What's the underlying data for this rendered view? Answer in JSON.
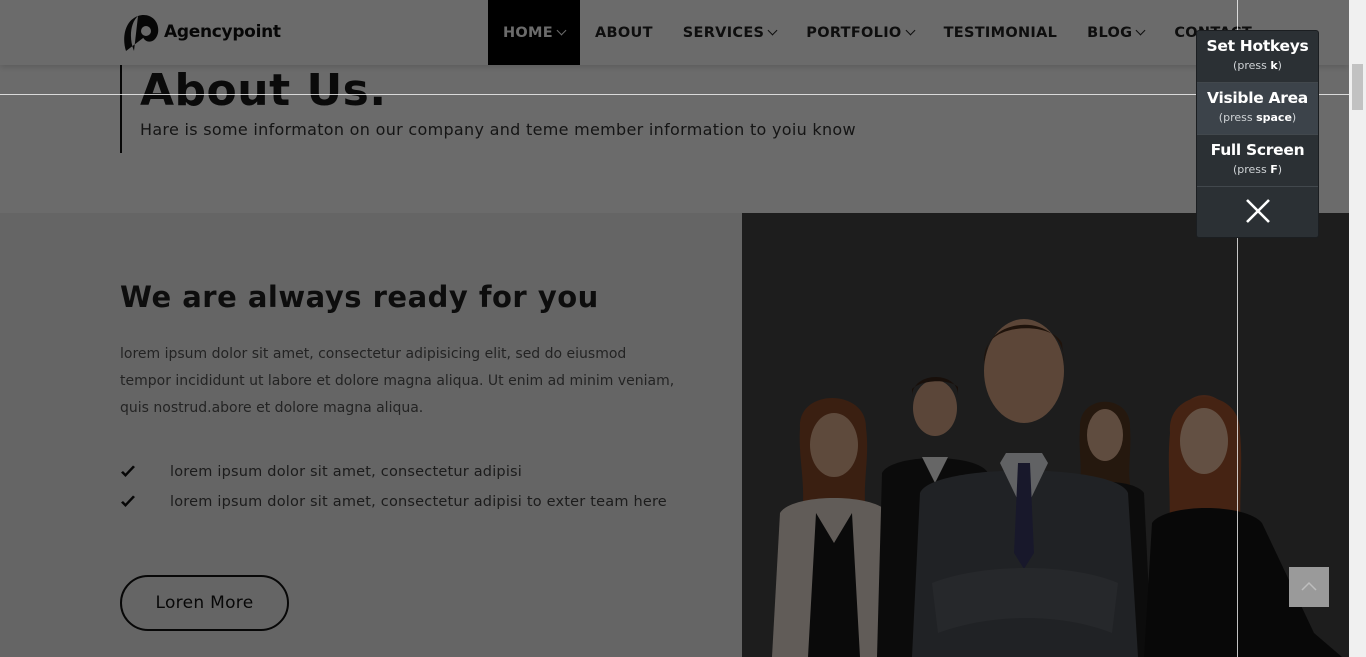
{
  "brand": {
    "name": "Agencypoint"
  },
  "nav": {
    "items": [
      {
        "label": "HOME",
        "dropdown": true,
        "active": true
      },
      {
        "label": "ABOUT",
        "dropdown": false
      },
      {
        "label": "SERVICES",
        "dropdown": true
      },
      {
        "label": "PORTFOLIO",
        "dropdown": true
      },
      {
        "label": "TESTIMONIAL",
        "dropdown": false
      },
      {
        "label": "BLOG",
        "dropdown": true
      },
      {
        "label": "CONTACT",
        "dropdown": false
      }
    ]
  },
  "about": {
    "title": "About Us.",
    "subtitle": "Hare is some informaton on our company and teme member information to yoiu know"
  },
  "section": {
    "title": "We are always ready for you",
    "paragraph": "lorem ipsum dolor sit amet, consectetur adipisicing elit, sed do eiusmod tempor incididunt ut labore et dolore magna aliqua. Ut enim ad minim veniam, quis nostrud.abore et dolore magna aliqua.",
    "checks": [
      "lorem ipsum dolor sit amet, consectetur adipisi",
      "lorem ipsum dolor sit amet, consectetur adipisi to exter team here"
    ],
    "button_label": "Loren More"
  },
  "hotkeys": {
    "items": [
      {
        "label": "Set Hotkeys",
        "press": "(press ",
        "key": "k",
        "close": ")"
      },
      {
        "label": "Visible Area",
        "press": "(press ",
        "key": "space",
        "close": ")"
      },
      {
        "label": "Full Screen",
        "press": "(press ",
        "key": "F",
        "close": ")"
      }
    ]
  },
  "icons": {
    "check": "check-icon",
    "chevron": "chevron-down-icon",
    "close": "close-icon",
    "to_top": "chevron-up-icon"
  },
  "colors": {
    "overlay": "#000000",
    "panel": "#2b3034",
    "nav_active": "#000000"
  }
}
